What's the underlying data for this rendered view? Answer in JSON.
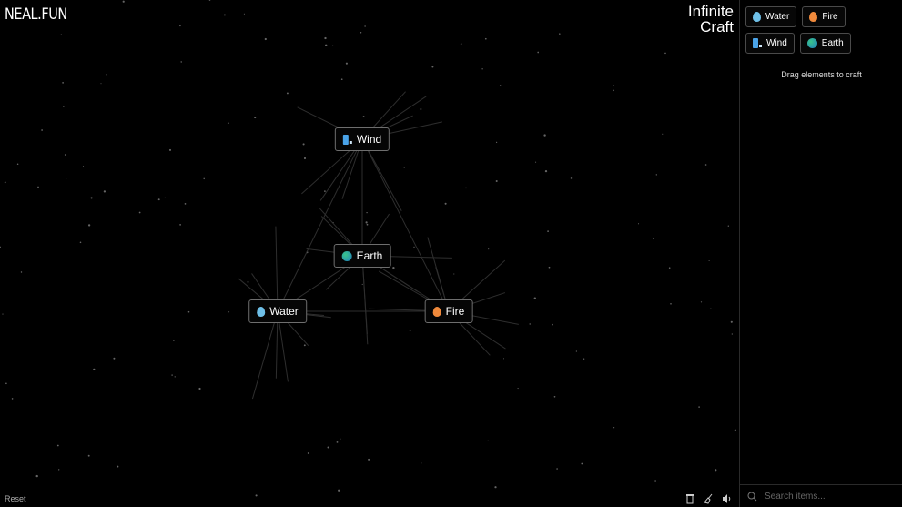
{
  "header": {
    "logo": "NEAL.FUN",
    "brand_line1": "Infinite",
    "brand_line2": "Craft"
  },
  "canvas_items": [
    {
      "name": "Wind",
      "icon": "wind-icon"
    },
    {
      "name": "Earth",
      "icon": "earth-icon"
    },
    {
      "name": "Water",
      "icon": "water-icon"
    },
    {
      "name": "Fire",
      "icon": "fire-icon"
    }
  ],
  "sidebar": {
    "items": [
      {
        "name": "Water",
        "icon": "water-icon"
      },
      {
        "name": "Fire",
        "icon": "fire-icon"
      },
      {
        "name": "Wind",
        "icon": "wind-icon"
      },
      {
        "name": "Earth",
        "icon": "earth-icon"
      }
    ],
    "hint": "Drag elements to craft",
    "search_placeholder": "Search items..."
  },
  "footer": {
    "reset": "Reset",
    "tools": [
      "coffee-icon",
      "broom-icon",
      "sound-icon"
    ]
  },
  "colors": {
    "background": "#000000",
    "item_border": "#6e6e6e",
    "water": "#6fc0e8",
    "fire": "#f08a3c",
    "wind": "#4aa3e8"
  }
}
